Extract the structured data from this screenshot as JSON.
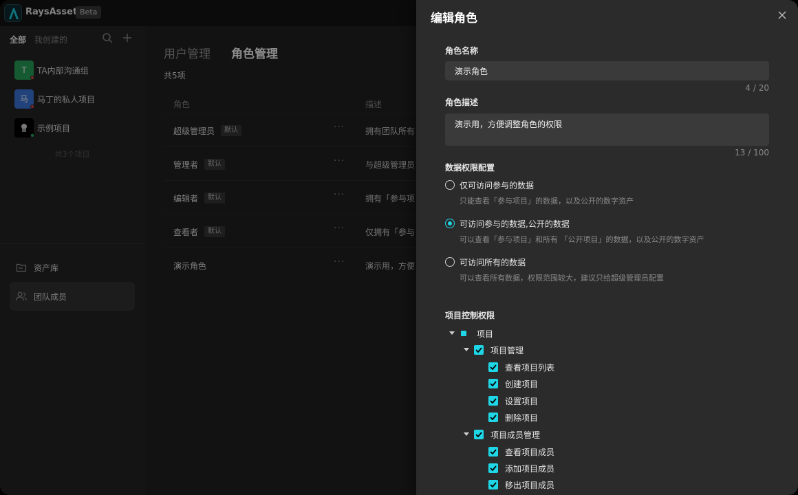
{
  "app": {
    "brand": "RaysAssets",
    "badge": "Beta"
  },
  "sidebar": {
    "tabs": [
      "全部",
      "我创建的"
    ],
    "projects": [
      {
        "avatar": "T",
        "name": "TA内部沟通组",
        "color": "#27a559",
        "dot": "#e5484d"
      },
      {
        "avatar": "马",
        "name": "马丁的私人项目",
        "color": "#3d79e0",
        "dot": "#e5484d"
      },
      {
        "avatar": "",
        "name": "示例项目",
        "color": "#000000",
        "dot": "#22b35e"
      }
    ],
    "project_count": "共3个项目",
    "nav": [
      {
        "label": "资产库",
        "icon": "folder-icon"
      },
      {
        "label": "团队成员",
        "icon": "users-icon"
      }
    ]
  },
  "main": {
    "tabs": [
      "用户管理",
      "角色管理"
    ],
    "total": "共5项",
    "columns": [
      "角色",
      "描述"
    ],
    "rows": [
      {
        "name": "超级管理员",
        "badge": "默认",
        "desc": "拥有团队所有"
      },
      {
        "name": "管理者",
        "badge": "默认",
        "desc": "与超级管理员"
      },
      {
        "name": "编辑者",
        "badge": "默认",
        "desc": "拥有「参与项"
      },
      {
        "name": "查看者",
        "badge": "默认",
        "desc": "仅拥有「参与"
      },
      {
        "name": "演示角色",
        "badge": "",
        "desc": "演示用，方便"
      }
    ]
  },
  "drawer": {
    "title": "编辑角色",
    "name_label": "角色名称",
    "name_value": "演示角色",
    "name_counter": "4 / 20",
    "desc_label": "角色描述",
    "desc_value": "演示用，方便调整角色的权限",
    "desc_counter": "13 / 100",
    "data_perm_label": "数据权限配置",
    "data_options": [
      {
        "label": "仅可访问参与的数据",
        "desc": "只能查看「参与项目」的数据，以及公开的数字资产",
        "checked": false
      },
      {
        "label": "可访问参与的数据,公开的数据",
        "desc": "可以查看「参与项目」和所有 「公开项目」的数据，以及公开的数字资产",
        "checked": true
      },
      {
        "label": "可访问所有的数据",
        "desc": "可以查看所有数据，权限范围较大，建议只给超级管理员配置",
        "checked": false
      }
    ],
    "project_perm_label": "项目控制权限",
    "tree": [
      {
        "label": "项目",
        "level": 0,
        "caret": true,
        "state": "partial"
      },
      {
        "label": "项目管理",
        "level": 1,
        "caret": true,
        "state": "checked"
      },
      {
        "label": "查看项目列表",
        "level": 2,
        "caret": false,
        "state": "checked"
      },
      {
        "label": "创建项目",
        "level": 2,
        "caret": false,
        "state": "checked"
      },
      {
        "label": "设置项目",
        "level": 2,
        "caret": false,
        "state": "checked"
      },
      {
        "label": "删除项目",
        "level": 2,
        "caret": false,
        "state": "checked"
      },
      {
        "label": "项目成员管理",
        "level": 1,
        "caret": true,
        "state": "checked"
      },
      {
        "label": "查看项目成员",
        "level": 2,
        "caret": false,
        "state": "checked"
      },
      {
        "label": "添加项目成员",
        "level": 2,
        "caret": false,
        "state": "checked"
      },
      {
        "label": "移出项目成员",
        "level": 2,
        "caret": false,
        "state": "checked"
      }
    ]
  },
  "colors": {
    "accent": "#1ed6e6"
  }
}
